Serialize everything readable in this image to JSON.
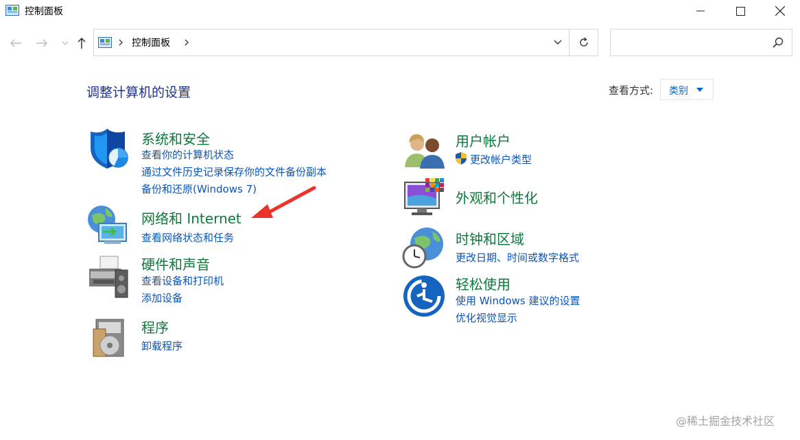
{
  "window": {
    "title": "控制面板"
  },
  "address": {
    "crumb": "控制面板"
  },
  "search": {
    "placeholder": ""
  },
  "main": {
    "heading": "调整计算机的设置"
  },
  "view_by": {
    "label": "查看方式:",
    "value": "类别"
  },
  "categories": [
    {
      "title": "系统和安全",
      "icon": "shield-icon",
      "links": [
        "查看你的计算机状态",
        "通过文件历史记录保存你的文件备份副本",
        "备份和还原(Windows 7)"
      ]
    },
    {
      "title": "网络和 Internet",
      "icon": "network-icon",
      "links": [
        "查看网络状态和任务"
      ]
    },
    {
      "title": "硬件和声音",
      "icon": "printer-icon",
      "links": [
        "查看设备和打印机",
        "添加设备"
      ]
    },
    {
      "title": "程序",
      "icon": "programs-icon",
      "links": [
        "卸载程序"
      ]
    },
    {
      "title": "用户帐户",
      "icon": "users-icon",
      "links": [
        "更改帐户类型"
      ]
    },
    {
      "title": "外观和个性化",
      "icon": "monitor-icon",
      "links": []
    },
    {
      "title": "时钟和区域",
      "icon": "clock-globe-icon",
      "links": [
        "更改日期、时间或数字格式"
      ]
    },
    {
      "title": "轻松使用",
      "icon": "ease-of-access-icon",
      "links": [
        "使用 Windows 建议的设置",
        "优化视觉显示"
      ]
    }
  ],
  "watermark": "@稀土掘金技术社区",
  "colors": {
    "heading": "#1e3287",
    "category_title": "#0b7a3a",
    "link": "#0c55b7",
    "annotation_arrow": "#e8342a"
  }
}
